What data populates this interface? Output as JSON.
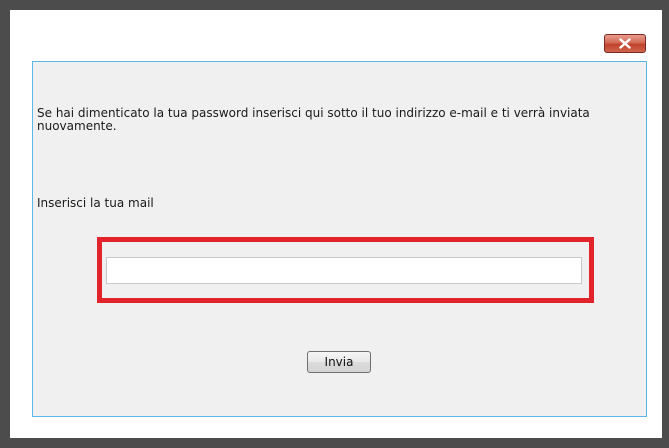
{
  "dialog": {
    "close_icon": "close-x-icon",
    "instructions": "Se hai dimenticato la tua password inserisci qui sotto il tuo indirizzo e-mail e ti verrà inviata nuovamente.",
    "email_label": "Inserisci la tua mail",
    "email_value": "",
    "send_label": "Invia",
    "highlight_color": "#e3232b",
    "panel_border_color": "#5bb8e6"
  }
}
